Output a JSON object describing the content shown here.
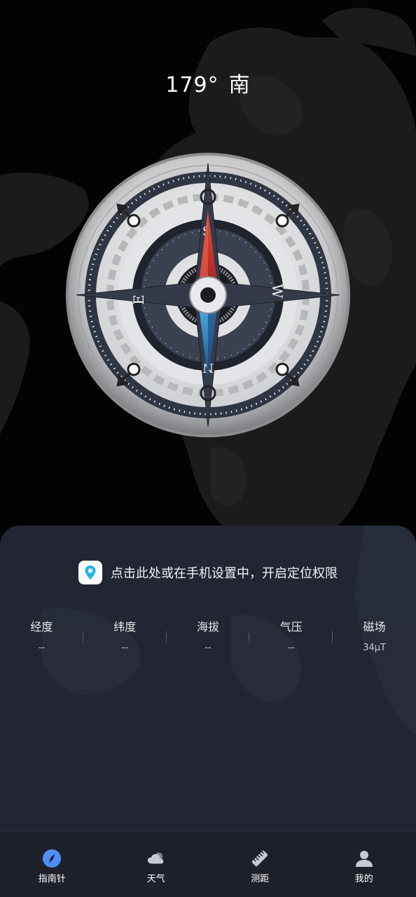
{
  "heading": {
    "degrees": "179°",
    "direction": "南"
  },
  "compass": {
    "north_letter": "S",
    "east_letter": "E",
    "west_letter": "W",
    "south_letter": "N"
  },
  "permission": {
    "text": "点击此处或在手机设置中，开启定位权限"
  },
  "stats": [
    {
      "label": "经度",
      "value": "--"
    },
    {
      "label": "纬度",
      "value": "--"
    },
    {
      "label": "海拔",
      "value": "--"
    },
    {
      "label": "气压",
      "value": "--"
    },
    {
      "label": "磁场",
      "value": "34μT"
    }
  ],
  "nav": {
    "items": [
      {
        "label": "指南针",
        "icon": "compass-icon",
        "active": true
      },
      {
        "label": "天气",
        "icon": "cloud-icon",
        "active": false
      },
      {
        "label": "测距",
        "icon": "ruler-icon",
        "active": false
      },
      {
        "label": "我的",
        "icon": "person-icon",
        "active": false
      }
    ]
  },
  "colors": {
    "background": "#030303",
    "panel": "#222632",
    "nav_bar": "#1d2029",
    "accent_blue": "#4f8ef7",
    "needle_red": "#d93b35",
    "needle_blue": "#2f7fc6",
    "location_pin": "#1fb4e6"
  }
}
